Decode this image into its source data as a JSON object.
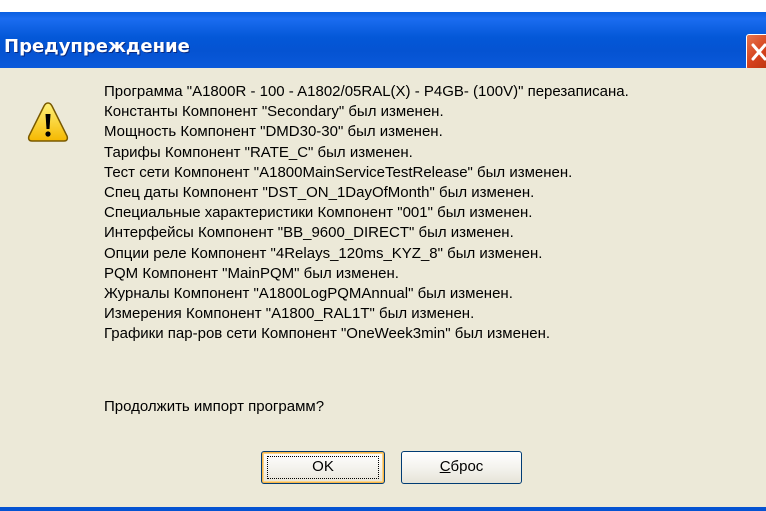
{
  "dialog": {
    "title": "Предупреждение",
    "icon": "warning-icon",
    "message_lines": [
      "Программа \"A1800R - 100 - A1802/05RAL(X) - P4GB- (100V)\" перезаписана.",
      "Константы Компонент \"Secondary\" был изменен.",
      "Мощность Компонент \"DMD30-30\" был изменен.",
      "Тарифы Компонент \"RATE_C\" был изменен.",
      "Тест сети Компонент \"A1800MainServiceTestRelease\" был изменен.",
      "Спец  даты Компонент \"DST_ON_1DayOfMonth\" был изменен.",
      "Специальные характеристики Компонент \"001\" был изменен.",
      "Интерфейсы Компонент \"BB_9600_DIRECT\" был изменен.",
      "Опции реле Компонент \"4Relays_120ms_KYZ_8\" был изменен.",
      "PQM Компонент \"MainPQM\" был изменен.",
      "Журналы Компонент \"A1800LogPQMAnnual\" был изменен.",
      "Измерения Компонент \"A1800_RAL1T\" был изменен.",
      "Графики пар-ров сети Компонент \"OneWeek3min\" был изменен."
    ],
    "prompt": "Продолжить импорт программ?",
    "buttons": {
      "ok_label": "OK",
      "reset_first_letter": "С",
      "reset_rest": "брос"
    }
  },
  "colors": {
    "titlebar": "#0553d2",
    "dialog_bg": "#ece9d8",
    "close_button": "#d4411c",
    "warning_yellow": "#ffd21a"
  }
}
